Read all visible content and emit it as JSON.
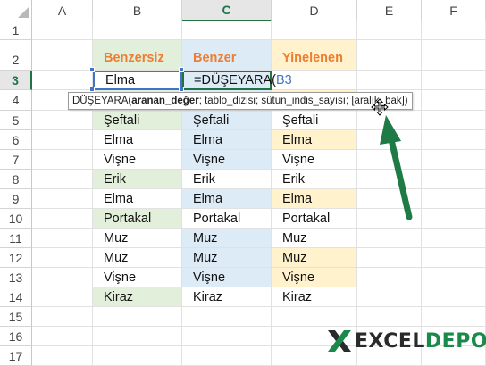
{
  "columns": [
    "A",
    "B",
    "C",
    "D",
    "E",
    "F"
  ],
  "rows": [
    "1",
    "2",
    "3",
    "4",
    "5",
    "6",
    "7",
    "8",
    "9",
    "10",
    "11",
    "12",
    "13",
    "14",
    "15",
    "16",
    "17"
  ],
  "headers": {
    "b": "Benzersiz",
    "c": "Benzer",
    "d": "Yinelenen"
  },
  "row3": {
    "b": "Elma",
    "c_prefix": "=DÜŞEYARA(",
    "c_ref": "B3"
  },
  "data_rows": [
    {
      "b": "Şeftali",
      "c": "Şeftali",
      "d": "Şeftali"
    },
    {
      "b": "Elma",
      "c": "Elma",
      "d": "Elma"
    },
    {
      "b": "Vişne",
      "c": "Vişne",
      "d": "Vişne"
    },
    {
      "b": "Erik",
      "c": "Erik",
      "d": "Erik"
    },
    {
      "b": "Elma",
      "c": "Elma",
      "d": "Elma"
    },
    {
      "b": "Portakal",
      "c": "Portakal",
      "d": "Portakal"
    },
    {
      "b": "Muz",
      "c": "Muz",
      "d": "Muz"
    },
    {
      "b": "Muz",
      "c": "Muz",
      "d": "Muz"
    },
    {
      "b": "Vişne",
      "c": "Vişne",
      "d": "Vişne"
    },
    {
      "b": "Kiraz",
      "c": "Kiraz",
      "d": "Kiraz"
    }
  ],
  "tooltip": {
    "fn": "DÜŞEYARA(",
    "arg1": "aranan_değer",
    "rest": "; tablo_dizisi; sütun_indis_sayısı; [aralık_bak])"
  },
  "logo": {
    "part1": "EXCEL",
    "part2": "DEPO"
  },
  "colors": {
    "header_text": "#ed7d31",
    "unique_fill": "#e2efda",
    "similar_fill": "#ddebf7",
    "duplicate_fill": "#fff2cc",
    "arrow": "#1e7b45",
    "active_header": "#217346"
  },
  "icons": {
    "move_cursor": "move-cursor-icon",
    "arrow": "pointer-arrow-icon"
  }
}
